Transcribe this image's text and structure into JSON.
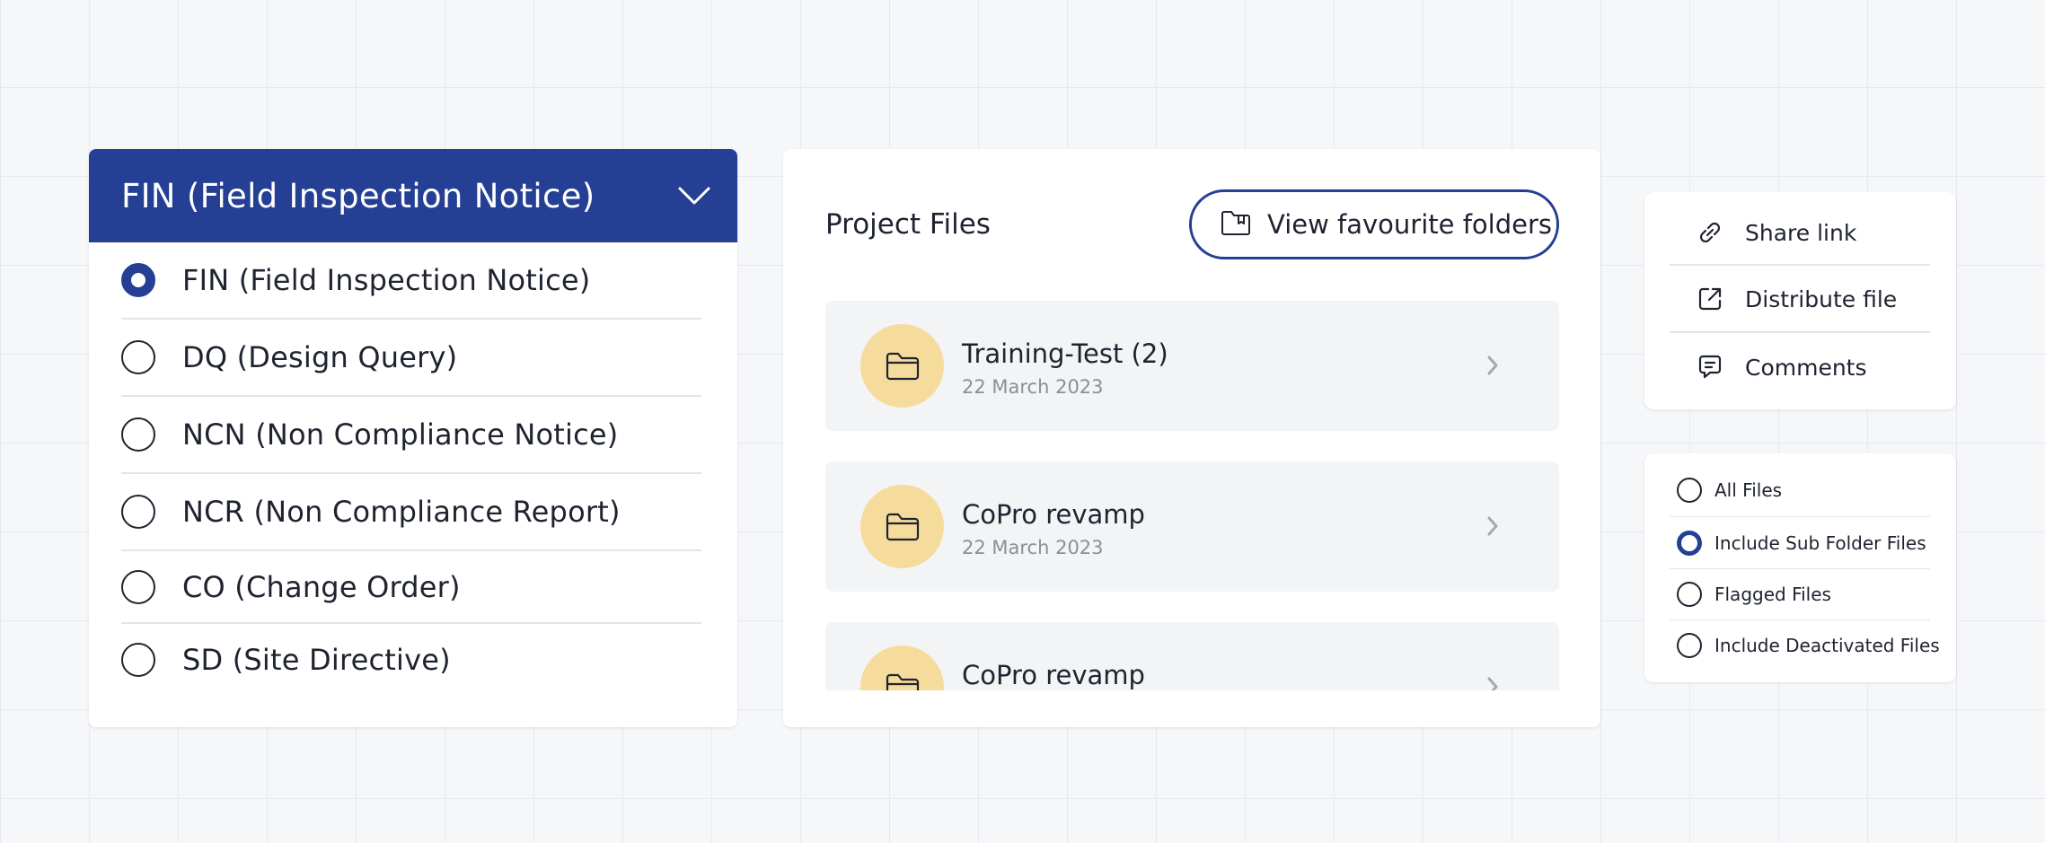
{
  "type_selector": {
    "selected_label": "FIN (Field Inspection Notice)",
    "options": [
      {
        "label": "FIN (Field Inspection Notice)",
        "selected": true
      },
      {
        "label": "DQ (Design Query)",
        "selected": false
      },
      {
        "label": "NCN (Non Compliance Notice)",
        "selected": false
      },
      {
        "label": "NCR (Non Compliance Report)",
        "selected": false
      },
      {
        "label": "CO (Change Order)",
        "selected": false
      },
      {
        "label": "SD (Site Directive)",
        "selected": false
      }
    ]
  },
  "project_files": {
    "title": "Project Files",
    "favourite_button": "View favourite folders",
    "folders": [
      {
        "name": "Training-Test (2)",
        "date": "22 March 2023"
      },
      {
        "name": "CoPro revamp",
        "date": "22 March 2023"
      },
      {
        "name": "CoPro revamp",
        "date": ""
      }
    ]
  },
  "share_menu": {
    "items": [
      {
        "label": "Share link",
        "icon": "link-icon"
      },
      {
        "label": "Distribute file",
        "icon": "external-link-icon"
      },
      {
        "label": "Comments",
        "icon": "comment-icon"
      }
    ]
  },
  "file_filter": {
    "options": [
      {
        "label": "All Files",
        "selected": false
      },
      {
        "label": "Include Sub Folder Files",
        "selected": true
      },
      {
        "label": "Flagged Files",
        "selected": false
      },
      {
        "label": "Include Deactivated Files",
        "selected": false
      }
    ]
  },
  "colors": {
    "primary": "#253f94",
    "folder_badge": "#f6dc9c",
    "row_background": "#f3f4f6",
    "muted_text": "#8a8f99"
  }
}
